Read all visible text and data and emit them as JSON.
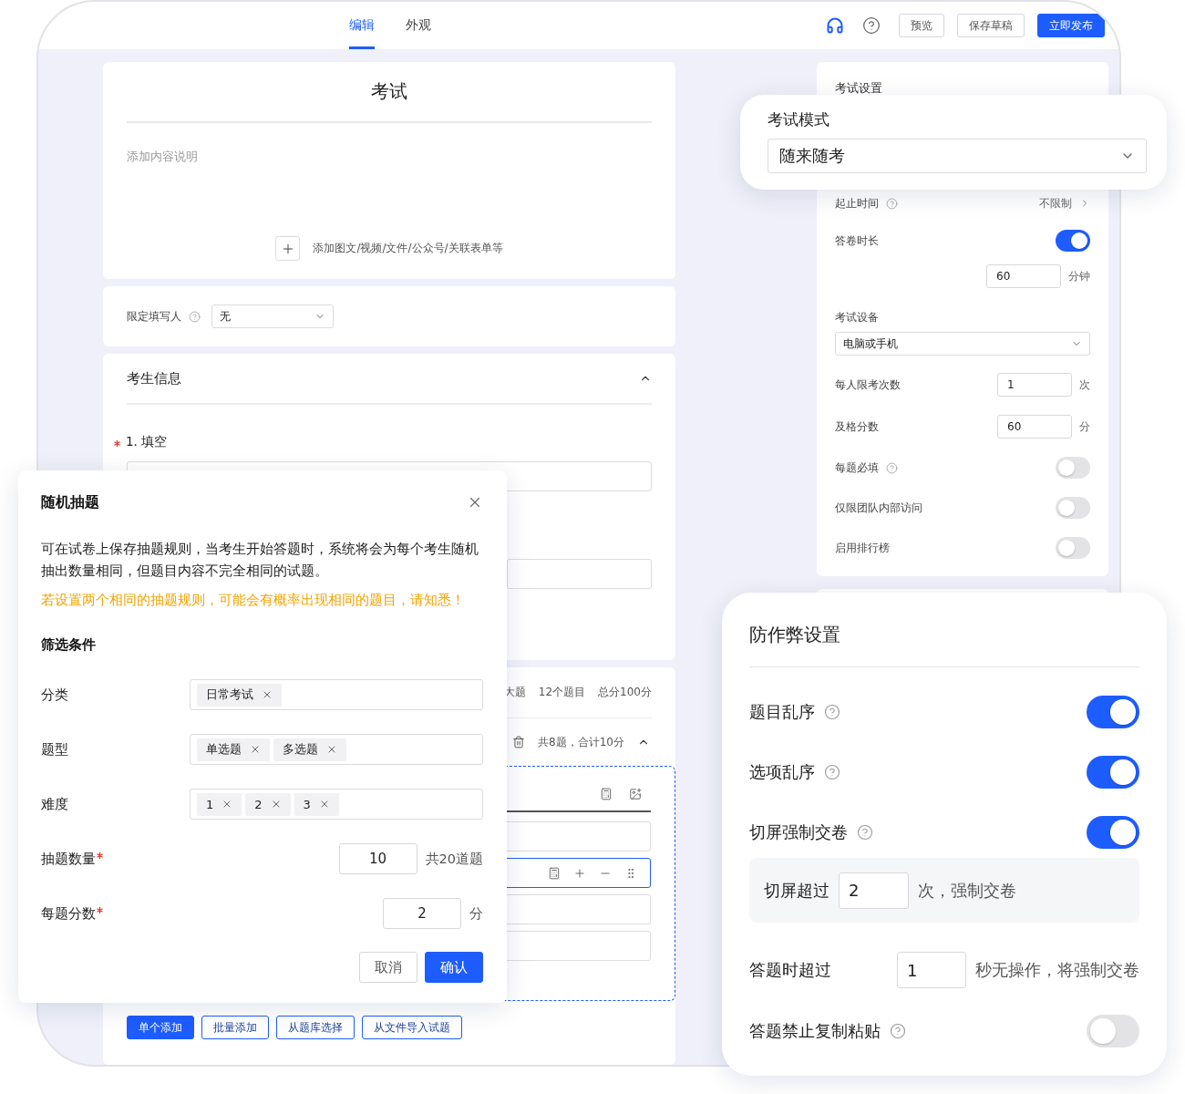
{
  "header": {
    "tabs": [
      {
        "label": "编辑",
        "selected": true
      },
      {
        "label": "外观",
        "selected": false
      }
    ],
    "buttons": [
      {
        "label": "预览",
        "kind": "outline"
      },
      {
        "label": "保存草稿",
        "kind": "outline"
      },
      {
        "label": "立即发布",
        "kind": "primary"
      }
    ]
  },
  "form": {
    "title": "考试",
    "description_hint": "添加内容说明",
    "add_media": "添加图文/视频/文件/公众号/关联表单等",
    "restrict": {
      "label": "限定填写人",
      "help": true,
      "value": "无"
    },
    "candidate_info": {
      "title": "考生信息",
      "expanded": true,
      "questions": [
        {
          "label": "1. 填空",
          "required": true
        }
      ]
    },
    "section": {
      "stats": [
        "大题",
        "12个题目",
        "总分100分"
      ],
      "summary": "共8题，合计10分",
      "expanded": true,
      "option_fields": [
        {
          "selected": false
        },
        {
          "selected": true
        },
        {
          "selected": false
        },
        {
          "selected": false
        }
      ],
      "add_buttons": [
        {
          "label": "单个添加",
          "kind": "primary"
        },
        {
          "label": "批量添加",
          "kind": "outline"
        },
        {
          "label": "从题库选择",
          "kind": "outline"
        },
        {
          "label": "从文件导入试题",
          "kind": "outline"
        }
      ]
    }
  },
  "settings": {
    "title": "考试设置",
    "rows": [
      {
        "kind": "link",
        "label": "起止时间",
        "help": true,
        "value": "不限制"
      },
      {
        "kind": "toggle",
        "label": "答卷时长",
        "help": false,
        "on": true
      },
      {
        "kind": "amount",
        "value": "60",
        "unit": "分钟"
      },
      {
        "kind": "heading",
        "label": "考试设备"
      },
      {
        "kind": "select",
        "value": "电脑或手机"
      },
      {
        "kind": "number",
        "label": "每人限考次数",
        "help": false,
        "value": "1",
        "unit": "次"
      },
      {
        "kind": "number",
        "label": "及格分数",
        "help": false,
        "value": "60",
        "unit": "分"
      },
      {
        "kind": "toggle",
        "label": "每题必填",
        "help": true,
        "on": false
      },
      {
        "kind": "toggle",
        "label": "仅限团队内部访问",
        "help": false,
        "on": false
      },
      {
        "kind": "toggle",
        "label": "启用排行榜",
        "help": false,
        "on": false
      }
    ]
  },
  "exam_mode": {
    "label": "考试模式",
    "value": "随来随考"
  },
  "dialog": {
    "title": "随机抽题",
    "description": "可在试卷上保存抽题规则，当考生开始答题时，系统将会为每个考生随机抽出数量相同，但题目内容不完全相同的试题。",
    "warning": "若设置两个相同的抽题规则，可能会有概率出现相同的题目，请知悉！",
    "filter_title": "筛选条件",
    "filters": [
      {
        "kind": "tags",
        "label": "分类",
        "required": false,
        "tags": [
          "日常考试"
        ]
      },
      {
        "kind": "tags",
        "label": "题型",
        "required": false,
        "tags": [
          "单选题",
          "多选题"
        ]
      },
      {
        "kind": "tags",
        "label": "难度",
        "required": false,
        "tags": [
          "1",
          "2",
          "3"
        ]
      },
      {
        "kind": "number",
        "label": "抽题数量",
        "required": true,
        "value": "10",
        "suffix": "共20道题"
      },
      {
        "kind": "number",
        "label": "每题分数",
        "required": true,
        "value": "2",
        "suffix": "分"
      }
    ],
    "buttons": [
      {
        "label": "取消",
        "kind": "outline"
      },
      {
        "label": "确认",
        "kind": "primary"
      }
    ]
  },
  "anti_cheat": {
    "title": "防作弊设置",
    "rows": [
      {
        "kind": "toggle",
        "label": "题目乱序",
        "help": true,
        "on": true
      },
      {
        "kind": "toggle",
        "label": "选项乱序",
        "help": true,
        "on": true
      },
      {
        "kind": "toggle",
        "label": "切屏强制交卷",
        "help": true,
        "on": true
      },
      {
        "kind": "detail",
        "prefix": "切屏超过",
        "value": "2",
        "suffix": "次，强制交卷"
      },
      {
        "kind": "inline",
        "label": "答题时超过",
        "value": "1",
        "suffix": "秒无操作，将强制交卷"
      },
      {
        "kind": "toggle",
        "label": "答题禁止复制粘贴",
        "help": true,
        "on": false
      }
    ]
  }
}
